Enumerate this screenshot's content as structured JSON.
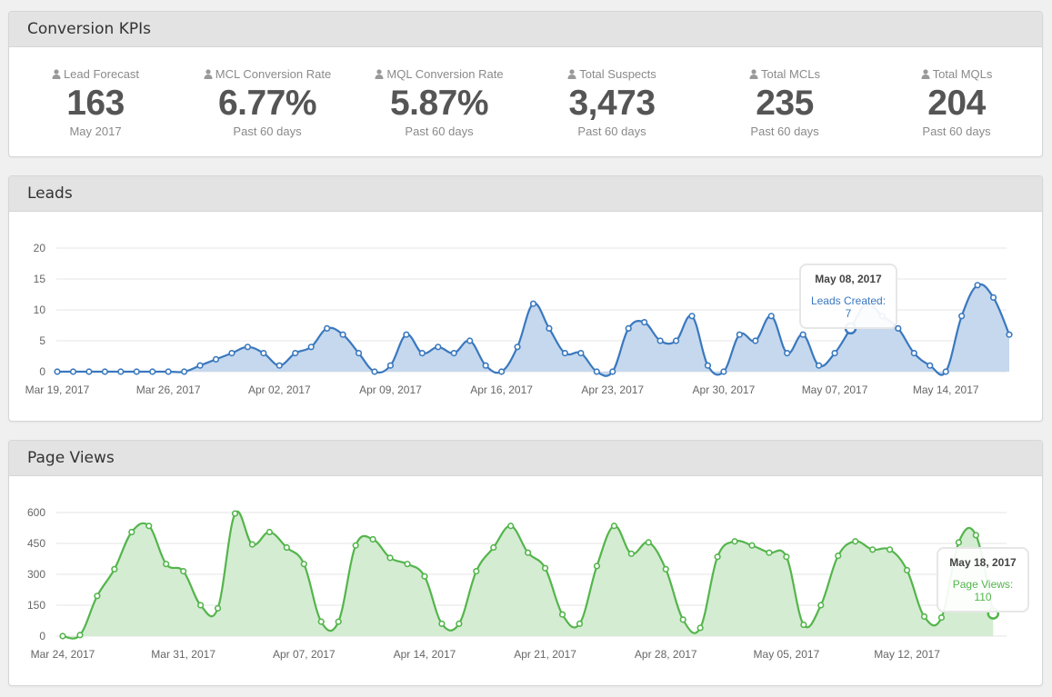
{
  "kpi_panel": {
    "title": "Conversion KPIs",
    "items": [
      {
        "label": "Lead Forecast",
        "value": "163",
        "sub": "May 2017"
      },
      {
        "label": "MCL Conversion Rate",
        "value": "6.77%",
        "sub": "Past 60 days"
      },
      {
        "label": "MQL Conversion Rate",
        "value": "5.87%",
        "sub": "Past 60 days"
      },
      {
        "label": "Total Suspects",
        "value": "3,473",
        "sub": "Past 60 days"
      },
      {
        "label": "Total MCLs",
        "value": "235",
        "sub": "Past 60 days"
      },
      {
        "label": "Total MQLs",
        "value": "204",
        "sub": "Past 60 days"
      }
    ]
  },
  "colors": {
    "leads": "#3a78be",
    "leads_fill": "#c5d8ee",
    "views": "#54b54c",
    "views_fill": "#d4ecd2",
    "grid": "#e4e4e4"
  },
  "leads_panel": {
    "title": "Leads",
    "tooltip": {
      "date": "May 08, 2017",
      "series": "Leads Created",
      "value": "7"
    }
  },
  "views_panel": {
    "title": "Page Views",
    "tooltip": {
      "date": "May 18, 2017",
      "series": "Page Views",
      "value": "110"
    }
  },
  "chart_data": [
    {
      "type": "area",
      "title": "Leads",
      "start_date": "2017-03-19",
      "x_tick_labels": [
        "Mar 19, 2017",
        "Mar 26, 2017",
        "Apr 02, 2017",
        "Apr 09, 2017",
        "Apr 16, 2017",
        "Apr 23, 2017",
        "Apr 30, 2017",
        "May 07, 2017",
        "May 14, 2017"
      ],
      "y_ticks": [
        0,
        5,
        10,
        15,
        20
      ],
      "ylim": [
        0,
        20
      ],
      "series": [
        {
          "name": "Leads Created",
          "values": [
            0,
            0,
            0,
            0,
            0,
            0,
            0,
            0,
            0,
            1,
            2,
            3,
            4,
            3,
            1,
            3,
            4,
            7,
            6,
            3,
            0,
            1,
            6,
            3,
            4,
            3,
            5,
            1,
            0,
            4,
            11,
            7,
            3,
            3,
            0,
            0,
            7,
            8,
            5,
            5,
            9,
            1,
            0,
            6,
            5,
            9,
            3,
            6,
            1,
            3,
            7,
            11,
            9,
            7,
            3,
            1,
            0,
            9,
            14,
            12,
            6
          ]
        }
      ],
      "highlight_index": 50
    },
    {
      "type": "area",
      "title": "Page Views",
      "start_date": "2017-03-24",
      "x_tick_labels": [
        "Mar 24, 2017",
        "Mar 31, 2017",
        "Apr 07, 2017",
        "Apr 14, 2017",
        "Apr 21, 2017",
        "Apr 28, 2017",
        "May 05, 2017",
        "May 12, 2017"
      ],
      "y_ticks": [
        0,
        150,
        300,
        450,
        600
      ],
      "ylim": [
        0,
        600
      ],
      "series": [
        {
          "name": "Page Views",
          "values": [
            0,
            5,
            195,
            325,
            505,
            535,
            350,
            315,
            150,
            135,
            595,
            445,
            505,
            430,
            350,
            70,
            70,
            440,
            470,
            380,
            350,
            290,
            60,
            60,
            315,
            430,
            535,
            405,
            330,
            105,
            60,
            340,
            535,
            400,
            455,
            325,
            80,
            40,
            385,
            460,
            440,
            405,
            385,
            55,
            150,
            390,
            460,
            420,
            420,
            320,
            95,
            90,
            455,
            490,
            110
          ]
        }
      ],
      "highlight_index": 54
    }
  ]
}
